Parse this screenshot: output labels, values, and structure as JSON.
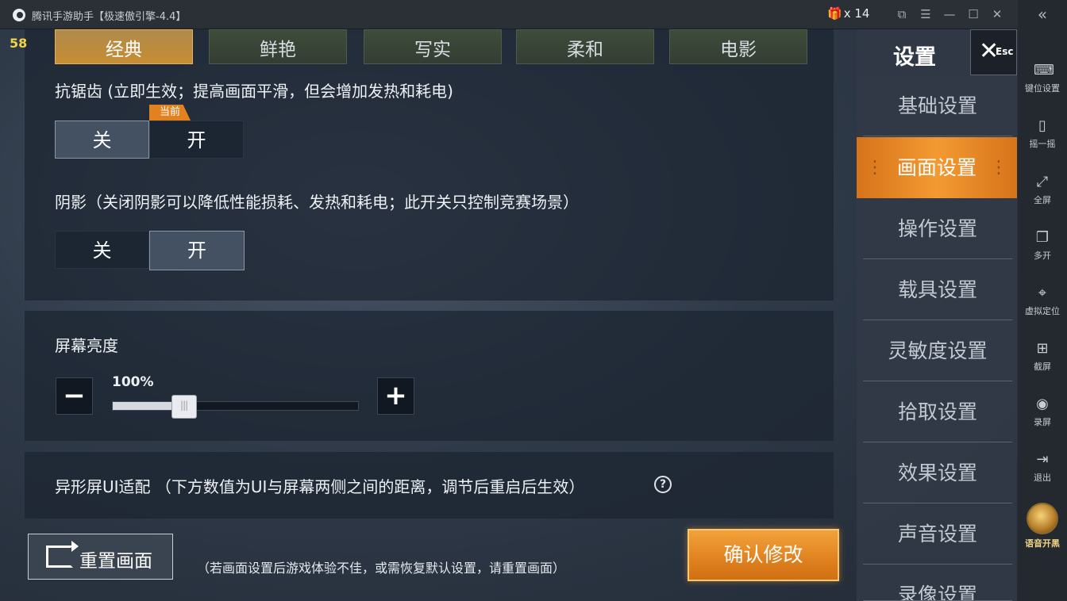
{
  "window": {
    "title": "腾讯手游助手【极速傲引擎-4.4】",
    "gift_count": "x 14"
  },
  "toolbar": {
    "items": [
      {
        "label": "键位设置",
        "icon": "keyboard-icon"
      },
      {
        "label": "摇一摇",
        "icon": "shake-icon"
      },
      {
        "label": "全屏",
        "icon": "fullscreen-icon"
      },
      {
        "label": "多开",
        "icon": "multi-instance-icon"
      },
      {
        "label": "虚拟定位",
        "icon": "location-icon"
      },
      {
        "label": "截屏",
        "icon": "screenshot-icon"
      },
      {
        "label": "录屏",
        "icon": "record-icon"
      },
      {
        "label": "退出",
        "icon": "exit-icon"
      },
      {
        "label": "语音开黑",
        "icon": "voice-chat-icon"
      }
    ]
  },
  "game": {
    "fps": "58",
    "quality_tabs": [
      "经典",
      "鲜艳",
      "写实",
      "柔和",
      "电影"
    ],
    "quality_selected": "经典",
    "antialias": {
      "label": "抗锯齿 (立即生效；提高画面平滑，但会增加发热和耗电)",
      "off": "关",
      "on": "开",
      "current_tag": "当前",
      "selected": "关"
    },
    "shadow": {
      "label": "阴影（关闭阴影可以降低性能损耗、发热和耗电；此开关只控制竞赛场景）",
      "off": "关",
      "on": "开",
      "selected": "开"
    },
    "brightness": {
      "label": "屏幕亮度",
      "value_text": "100%",
      "level": 0.29,
      "minus": "−",
      "plus": "+"
    },
    "notch": {
      "label": "异形屏UI适配 （下方数值为UI与屏幕两侧之间的距离，调节后重启后生效）",
      "help": "?"
    },
    "reset": {
      "label": "重置画面",
      "hint": "（若画面设置后游戏体验不佳，或需恢复默认设置，请重置画面）"
    },
    "confirm": "确认修改"
  },
  "menu": {
    "title": "设置",
    "esc": "Esc",
    "items": [
      "基础设置",
      "画面设置",
      "操作设置",
      "载具设置",
      "灵敏度设置",
      "拾取设置",
      "效果设置",
      "声音设置",
      "录像设置"
    ],
    "active": "画面设置"
  }
}
